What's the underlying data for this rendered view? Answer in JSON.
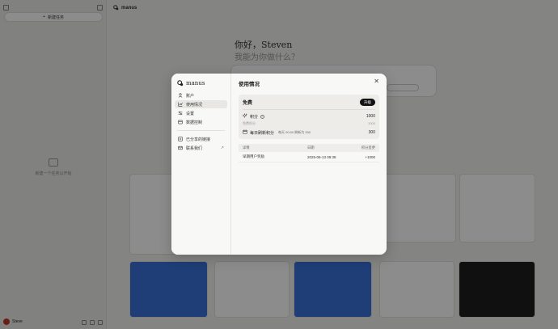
{
  "app": {
    "sidebar": {
      "new_task_label": "新建任务",
      "empty_text": "新建一个任务以开始",
      "user_name": "Steve"
    },
    "brand": "manus",
    "greeting": "你好，Steven",
    "subgreeting": "我能为你做什么？"
  },
  "modal": {
    "brand": "manus",
    "nav": [
      {
        "label": "账户",
        "icon": "user-icon"
      },
      {
        "label": "使用情况",
        "icon": "chart-icon"
      },
      {
        "label": "设置",
        "icon": "settings-icon"
      },
      {
        "label": "数据控制",
        "icon": "database-icon"
      }
    ],
    "nav_secondary": [
      {
        "label": "已分享的链接",
        "icon": "link-icon"
      },
      {
        "label": "联系我们",
        "icon": "mail-icon",
        "external": "↗"
      }
    ],
    "title": "使用情况",
    "plan": {
      "name": "免费",
      "upgrade_label": "升级",
      "credits_label": "积分",
      "credits_value": "1000",
      "free_credits_label": "免费积分",
      "free_credits_value": "1000",
      "daily_label": "每日刷新积分",
      "daily_note": "每天 00:00 刷新为 300",
      "daily_value": "300"
    },
    "table": {
      "headers": [
        "详情",
        "日期",
        "积分变更"
      ],
      "rows": [
        {
          "detail": "早期用户奖励",
          "date": "2025-06-13 09:38",
          "change": "+1000"
        }
      ]
    }
  }
}
